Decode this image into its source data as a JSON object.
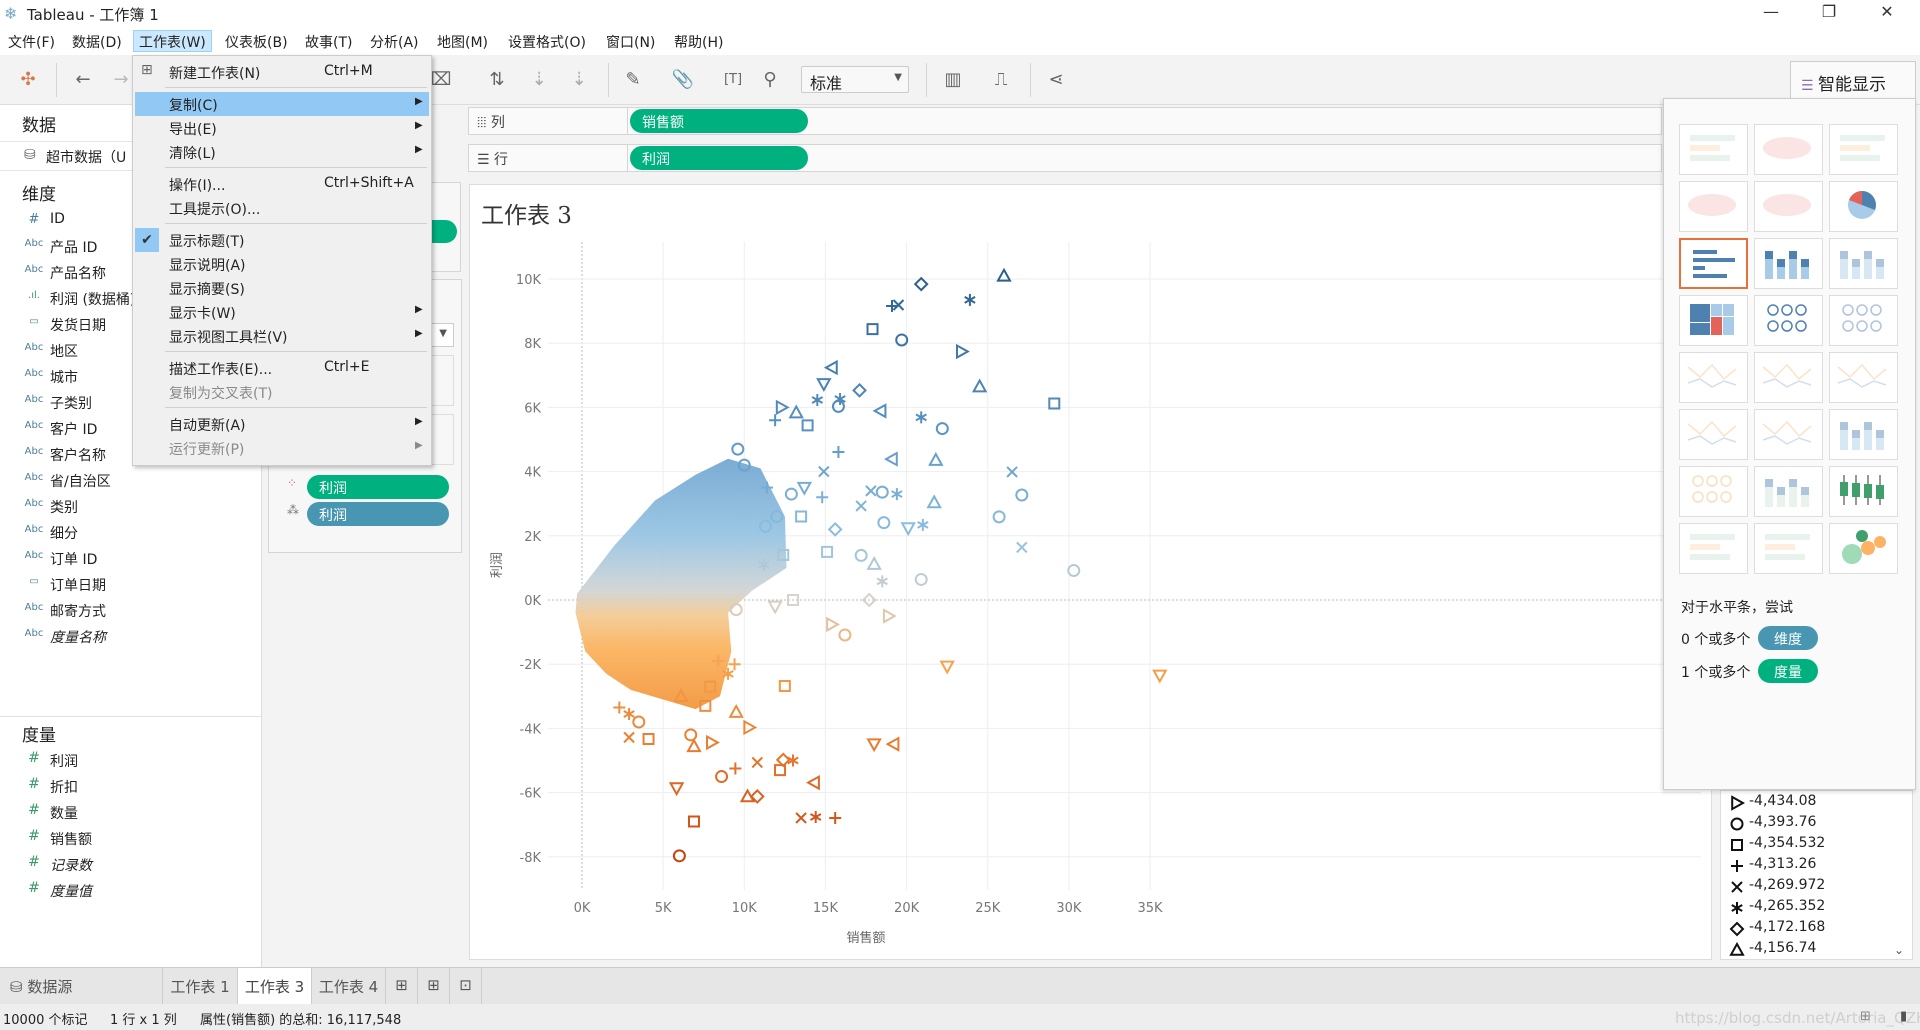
{
  "window": {
    "title": "Tableau - 工作簿 1",
    "controls": [
      "minimize",
      "restore",
      "close"
    ]
  },
  "menubar": [
    "文件(F)",
    "数据(D)",
    "工作表(W)",
    "仪表板(B)",
    "故事(T)",
    "分析(A)",
    "地图(M)",
    "设置格式(O)",
    "窗口(N)",
    "帮助(H)"
  ],
  "toolbar": {
    "fit_dropdown": "标准"
  },
  "worksheet_menu": {
    "items": [
      {
        "label": "新建工作表(N)",
        "shortcut": "Ctrl+M"
      },
      {
        "sep": true
      },
      {
        "label": "复制(C)",
        "submenu": true,
        "highlighted": true
      },
      {
        "label": "导出(E)",
        "submenu": true
      },
      {
        "label": "清除(L)",
        "submenu": true
      },
      {
        "sep": true
      },
      {
        "label": "操作(I)...",
        "shortcut": "Ctrl+Shift+A"
      },
      {
        "label": "工具提示(O)..."
      },
      {
        "sep": true
      },
      {
        "label": "显示标题(T)",
        "checked": true
      },
      {
        "label": "显示说明(A)"
      },
      {
        "label": "显示摘要(S)"
      },
      {
        "label": "显示卡(W)",
        "submenu": true
      },
      {
        "label": "显示视图工具栏(V)",
        "submenu": true
      },
      {
        "sep": true
      },
      {
        "label": "描述工作表(E)...",
        "shortcut": "Ctrl+E"
      },
      {
        "label": "复制为交叉表(T)",
        "disabled": true
      },
      {
        "sep": true
      },
      {
        "label": "自动更新(A)",
        "submenu": true
      },
      {
        "label": "运行更新(P)",
        "submenu": true,
        "disabled": true
      }
    ]
  },
  "data_pane": {
    "title": "数据",
    "datasource": "超市数据（U",
    "dimensions_label": "维度",
    "dimensions": [
      {
        "icon": "#",
        "label": "ID"
      },
      {
        "icon": "Abc",
        "label": "产品 ID"
      },
      {
        "icon": "Abc",
        "label": "产品名称"
      },
      {
        "icon": "bin",
        "label": "利润 (数据桶)"
      },
      {
        "icon": "date",
        "label": "发货日期"
      },
      {
        "icon": "Abc",
        "label": "地区"
      },
      {
        "icon": "Abc",
        "label": "城市"
      },
      {
        "icon": "Abc",
        "label": "子类别"
      },
      {
        "icon": "Abc",
        "label": "客户 ID"
      },
      {
        "icon": "Abc",
        "label": "客户名称"
      },
      {
        "icon": "Abc",
        "label": "省/自治区"
      },
      {
        "icon": "Abc",
        "label": "类别"
      },
      {
        "icon": "Abc",
        "label": "细分"
      },
      {
        "icon": "Abc",
        "label": "订单 ID"
      },
      {
        "icon": "date",
        "label": "订单日期"
      },
      {
        "icon": "Abc",
        "label": "邮寄方式"
      },
      {
        "icon": "Abc",
        "label": "度量名称",
        "italic": true
      }
    ],
    "measures_label": "度量",
    "measures": [
      {
        "label": "利润"
      },
      {
        "label": "折扣"
      },
      {
        "label": "数量"
      },
      {
        "label": "销售额"
      },
      {
        "label": "记录数",
        "italic": true
      },
      {
        "label": "度量值",
        "italic": true
      }
    ]
  },
  "shelves": {
    "columns_label": "列",
    "columns_pill": "销售额",
    "rows_label": "行",
    "rows_pill": "利润"
  },
  "marks": {
    "color_pill": "利润",
    "shape_pill": "利润"
  },
  "sheet": {
    "title": "工作表 3"
  },
  "chart_data": {
    "type": "scatter",
    "xlabel": "销售额",
    "ylabel": "利润",
    "xlim": [
      -2,
      40
    ],
    "ylim": [
      -9,
      10.8
    ],
    "x_ticks": [
      "0K",
      "5K",
      "10K",
      "15K",
      "20K",
      "25K",
      "30K",
      "35K"
    ],
    "x_tick_values": [
      0,
      5,
      10,
      15,
      20,
      25,
      30,
      35
    ],
    "y_ticks": [
      "10K",
      "8K",
      "6K",
      "4K",
      "2K",
      "0K",
      "-2K",
      "-4K",
      "-6K",
      "-8K"
    ],
    "y_tick_values": [
      10,
      8,
      6,
      4,
      2,
      0,
      -2,
      -4,
      -6,
      -8
    ],
    "units": "thousands",
    "grid": true,
    "mark_count": 10000,
    "color": {
      "field": "利润",
      "stops": [
        [
          -8,
          "#c8410f"
        ],
        [
          -5,
          "#e4762b"
        ],
        [
          -2,
          "#f7a24d"
        ],
        [
          0,
          "#d6d3cc"
        ],
        [
          2,
          "#8fc0df"
        ],
        [
          5,
          "#5c97c7"
        ],
        [
          10,
          "#2c5f90"
        ]
      ]
    },
    "dense_region": [
      [
        -0.3,
        0.2
      ],
      [
        2,
        1.7
      ],
      [
        4.5,
        3.1
      ],
      [
        7,
        3.9
      ],
      [
        9,
        4.4
      ],
      [
        11,
        4.1
      ],
      [
        12.5,
        2.6
      ],
      [
        12.6,
        1.0
      ],
      [
        10.5,
        0.3
      ],
      [
        9,
        -0.4
      ],
      [
        9.2,
        -1.6
      ],
      [
        8.5,
        -3
      ],
      [
        7,
        -3.4
      ],
      [
        5,
        -3.1
      ],
      [
        3,
        -2.8
      ],
      [
        1.5,
        -2.3
      ],
      [
        0.2,
        -1.6
      ],
      [
        -0.4,
        -0.4
      ]
    ],
    "points": [
      [
        26.0,
        10.1,
        "tri-up"
      ],
      [
        20.9,
        9.84,
        "diamond"
      ],
      [
        23.9,
        9.35,
        "asterisk"
      ],
      [
        19.1,
        9.16,
        "plus"
      ],
      [
        19.5,
        9.19,
        "x"
      ],
      [
        17.9,
        8.44,
        "square"
      ],
      [
        19.7,
        8.1,
        "circle"
      ],
      [
        23.4,
        7.74,
        "tri-right"
      ],
      [
        24.5,
        6.65,
        "tri-up"
      ],
      [
        29.1,
        6.12,
        "square"
      ],
      [
        15.4,
        7.24,
        "tri-left"
      ],
      [
        14.9,
        6.73,
        "tri-down"
      ],
      [
        17.1,
        6.53,
        "diamond"
      ],
      [
        14.5,
        6.23,
        "asterisk"
      ],
      [
        15.9,
        6.26,
        "asterisk"
      ],
      [
        15.8,
        6.03,
        "circle"
      ],
      [
        18.4,
        5.89,
        "tri-left"
      ],
      [
        20.9,
        5.69,
        "asterisk"
      ],
      [
        22.2,
        5.34,
        "circle"
      ],
      [
        11.9,
        5.6,
        "plus"
      ],
      [
        13.2,
        5.84,
        "tri-up"
      ],
      [
        12.3,
        6.0,
        "tri-right"
      ],
      [
        13.9,
        5.44,
        "square"
      ],
      [
        15.8,
        4.61,
        "plus"
      ],
      [
        19.1,
        4.39,
        "tri-left"
      ],
      [
        21.8,
        4.36,
        "tri-up"
      ],
      [
        26.5,
        3.99,
        "x"
      ],
      [
        27.1,
        3.27,
        "circle"
      ],
      [
        25.7,
        2.59,
        "circle"
      ],
      [
        27.1,
        1.64,
        "x"
      ],
      [
        30.3,
        0.92,
        "circle"
      ],
      [
        21.7,
        3.04,
        "tri-up"
      ],
      [
        20.1,
        2.24,
        "tri-down"
      ],
      [
        21.0,
        2.34,
        "asterisk"
      ],
      [
        18.6,
        2.41,
        "circle"
      ],
      [
        18.5,
        3.36,
        "circle"
      ],
      [
        19.4,
        3.3,
        "asterisk"
      ],
      [
        17.2,
        2.93,
        "x"
      ],
      [
        17.8,
        3.4,
        "x"
      ],
      [
        17.2,
        1.39,
        "circle"
      ],
      [
        18.0,
        1.12,
        "tri-up"
      ],
      [
        18.5,
        0.58,
        "asterisk"
      ],
      [
        20.9,
        0.64,
        "circle"
      ],
      [
        17.7,
        0.0,
        "diamond"
      ],
      [
        18.9,
        -0.5,
        "tri-right"
      ],
      [
        15.4,
        -0.76,
        "tri-right"
      ],
      [
        16.2,
        -1.09,
        "circle"
      ],
      [
        22.5,
        -2.07,
        "tri-down"
      ],
      [
        35.6,
        -2.35,
        "tri-down"
      ],
      [
        12.5,
        -2.68,
        "square"
      ],
      [
        18.0,
        -4.49,
        "tri-down"
      ],
      [
        19.2,
        -4.49,
        "tri-left"
      ],
      [
        10.3,
        -3.97,
        "tri-right"
      ],
      [
        9.5,
        -3.49,
        "tri-up"
      ],
      [
        13.0,
        -5.0,
        "asterisk"
      ],
      [
        12.4,
        -4.98,
        "diamond"
      ],
      [
        12.2,
        -5.3,
        "square"
      ],
      [
        10.8,
        -5.06,
        "x"
      ],
      [
        9.45,
        -5.25,
        "plus"
      ],
      [
        8.6,
        -5.5,
        "circle"
      ],
      [
        14.3,
        -5.69,
        "tri-left"
      ],
      [
        5.83,
        -5.86,
        "tri-down"
      ],
      [
        10.2,
        -6.12,
        "tri-up"
      ],
      [
        10.8,
        -6.12,
        "diamond"
      ],
      [
        6.9,
        -6.9,
        "square"
      ],
      [
        13.5,
        -6.79,
        "x"
      ],
      [
        14.4,
        -6.76,
        "asterisk"
      ],
      [
        15.6,
        -6.79,
        "plus"
      ],
      [
        6.0,
        -7.97,
        "circle"
      ],
      [
        4.1,
        -4.33,
        "square"
      ],
      [
        3.5,
        -3.8,
        "circle"
      ],
      [
        2.9,
        -4.28,
        "x"
      ],
      [
        2.9,
        -3.55,
        "asterisk"
      ],
      [
        2.3,
        -3.35,
        "plus"
      ],
      [
        6.9,
        -4.56,
        "tri-up"
      ],
      [
        8.0,
        -4.44,
        "tri-right"
      ],
      [
        6.7,
        -4.2,
        "circle"
      ],
      [
        7.6,
        -3.3,
        "square"
      ],
      [
        9.0,
        -2.3,
        "asterisk"
      ],
      [
        9.4,
        -2.0,
        "plus"
      ],
      [
        8.4,
        -1.9,
        "plus"
      ],
      [
        7.9,
        -2.7,
        "square"
      ],
      [
        6.1,
        -3.0,
        "triangle"
      ],
      [
        13.0,
        0.0,
        "square"
      ],
      [
        11.9,
        -0.2,
        "tri-down"
      ],
      [
        9.5,
        -0.3,
        "circle"
      ],
      [
        14.9,
        4.0,
        "x"
      ],
      [
        14.8,
        3.2,
        "plus"
      ],
      [
        15.1,
        1.5,
        "square"
      ],
      [
        15.6,
        2.2,
        "diamond"
      ],
      [
        12.0,
        2.6,
        "circle"
      ],
      [
        13.5,
        2.6,
        "square"
      ],
      [
        11.4,
        3.5,
        "plus"
      ],
      [
        10.0,
        4.2,
        "circle"
      ],
      [
        11.3,
        2.3,
        "circle"
      ],
      [
        9.6,
        4.7,
        "circle"
      ],
      [
        12.9,
        3.3,
        "circle"
      ],
      [
        13.7,
        3.5,
        "tri-down"
      ],
      [
        11.2,
        1.1,
        "asterisk"
      ],
      [
        12.4,
        1.4,
        "square"
      ]
    ]
  },
  "shape_legend": [
    {
      "shape": "tri-right",
      "value": "-4,434.08"
    },
    {
      "shape": "circle",
      "value": "-4,393.76"
    },
    {
      "shape": "square",
      "value": "-4,354.532"
    },
    {
      "shape": "plus",
      "value": "-4,313.26"
    },
    {
      "shape": "x",
      "value": "-4,269.972"
    },
    {
      "shape": "asterisk",
      "value": "-4,265.352"
    },
    {
      "shape": "diamond",
      "value": "-4,172.168"
    },
    {
      "shape": "tri-up",
      "value": "-4,156.74"
    }
  ],
  "show_me": {
    "title": "智能显示",
    "thumbnails": [
      "text-table",
      "heat-map",
      "highlight-table",
      "symbol-map",
      "filled-map",
      "pie",
      "horizontal-bars",
      "stacked-bars",
      "side-by-side-bars",
      "treemap",
      "circle-view",
      "side-by-side-circles",
      "lines-continuous",
      "lines-discrete",
      "dual-lines",
      "area-continuous",
      "area-discrete",
      "dual-combination",
      "scatter-plot",
      "histogram",
      "box-and-whisker",
      "gantt",
      "bullet-graph",
      "packed-bubbles"
    ],
    "selected": "horizontal-bars",
    "hint": "对于水平条，尝试",
    "req1_text": "0 个或多个",
    "req1_pill": "维度",
    "req2_text": "1 个或多个",
    "req2_pill": "度量"
  },
  "tabs": {
    "datasource": "数据源",
    "sheets": [
      "工作表 1",
      "工作表 3",
      "工作表 4"
    ],
    "active": "工作表 3"
  },
  "status": {
    "marks": "10000 个标记",
    "dims": "1 行 x 1 列",
    "sum": "属性(销售额) 的总和: 16,117,548"
  },
  "watermark": "https://blog.csdn.net/Artoria_QZH"
}
